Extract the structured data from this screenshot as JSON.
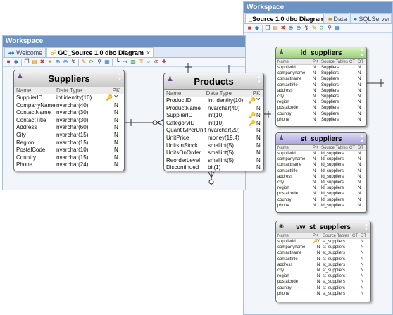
{
  "workspace_right": {
    "title": "Workspace",
    "tabs": [
      {
        "label": "_Source 1.0 dbo Diagram",
        "active": true
      },
      {
        "label": "Data",
        "active": false
      },
      {
        "label": "SQLServer",
        "active": false
      }
    ]
  },
  "workspace_left": {
    "title": "Workspace",
    "tabs": [
      {
        "label": "Welcome",
        "active": false
      },
      {
        "label": "GC_Source 1.0 dbo Diagram",
        "active": true,
        "close": "×"
      }
    ]
  },
  "toolbar_icons": [
    "stop-icon",
    "db-icon",
    "copy-icon",
    "paste-icon",
    "delete-icon",
    "arrange-icon",
    "zoom-in-icon",
    "zoom-out-icon",
    "link-icon",
    "pencil-icon",
    "refresh-icon",
    "filter-icon",
    "grid-icon",
    "layout-icon",
    "connect-icon",
    "table-icon",
    "key-icon",
    "search-icon",
    "options-icon",
    "pin-icon"
  ],
  "column_headers_big": {
    "name": "Name",
    "type": "Data Type",
    "pk": "PK"
  },
  "column_headers_small": {
    "name": "Name",
    "pk": "PK",
    "source": "Source Tables",
    "ct": "CT",
    "dt": "DT"
  },
  "suppliers": {
    "title": "Suppliers",
    "rows": [
      {
        "name": "SupplierID",
        "type": "int identity(10)",
        "key": "🔑",
        "pk": "Y"
      },
      {
        "name": "CompanyName",
        "type": "nvarchar(40)",
        "key": "",
        "pk": "N"
      },
      {
        "name": "ContactName",
        "type": "nvarchar(30)",
        "key": "",
        "pk": "N"
      },
      {
        "name": "ContactTitle",
        "type": "nvarchar(30)",
        "key": "",
        "pk": "N"
      },
      {
        "name": "Address",
        "type": "nvarchar(60)",
        "key": "",
        "pk": "N"
      },
      {
        "name": "City",
        "type": "nvarchar(15)",
        "key": "",
        "pk": "N"
      },
      {
        "name": "Region",
        "type": "nvarchar(15)",
        "key": "",
        "pk": "N"
      },
      {
        "name": "PostalCode",
        "type": "nvarchar(10)",
        "key": "",
        "pk": "N"
      },
      {
        "name": "Country",
        "type": "nvarchar(15)",
        "key": "",
        "pk": "N"
      },
      {
        "name": "Phone",
        "type": "nvarchar(24)",
        "key": "",
        "pk": "N"
      }
    ]
  },
  "products": {
    "title": "Products",
    "rows": [
      {
        "name": "ProductID",
        "type": "int identity(10)",
        "key": "🔑",
        "pk": "Y"
      },
      {
        "name": "ProductName",
        "type": "nvarchar(40)",
        "key": "",
        "pk": "N"
      },
      {
        "name": "SupplierID",
        "type": "int(10)",
        "key": "🔑",
        "pk": "N"
      },
      {
        "name": "CategoryID",
        "type": "int(10)",
        "key": "🔑",
        "pk": "N"
      },
      {
        "name": "QuantityPerUnit",
        "type": "nvarchar(20)",
        "key": "",
        "pk": "N"
      },
      {
        "name": "UnitPrice",
        "type": "money(19,4)",
        "key": "",
        "pk": "N"
      },
      {
        "name": "UnitsInStock",
        "type": "smallint(5)",
        "key": "",
        "pk": "N"
      },
      {
        "name": "UnitsOnOrder",
        "type": "smallint(5)",
        "key": "",
        "pk": "N"
      },
      {
        "name": "ReorderLevel",
        "type": "smallint(5)",
        "key": "",
        "pk": "N"
      },
      {
        "name": "Discontinued",
        "type": "bit(1)",
        "key": "",
        "pk": "N"
      }
    ]
  },
  "ld_suppliers": {
    "title": "ld_suppliers",
    "rows": [
      {
        "name": "supplierid",
        "key": "",
        "pk": "N",
        "source": "Suppliers",
        "ct": "",
        "dt": "N"
      },
      {
        "name": "companyname",
        "key": "",
        "pk": "N",
        "source": "Suppliers",
        "ct": "",
        "dt": "N"
      },
      {
        "name": "contactname",
        "key": "",
        "pk": "N",
        "source": "Suppliers",
        "ct": "",
        "dt": "N"
      },
      {
        "name": "contacttitle",
        "key": "",
        "pk": "N",
        "source": "Suppliers",
        "ct": "",
        "dt": "N"
      },
      {
        "name": "address",
        "key": "",
        "pk": "N",
        "source": "Suppliers",
        "ct": "",
        "dt": "N"
      },
      {
        "name": "city",
        "key": "",
        "pk": "N",
        "source": "Suppliers",
        "ct": "",
        "dt": "N"
      },
      {
        "name": "region",
        "key": "",
        "pk": "N",
        "source": "Suppliers",
        "ct": "",
        "dt": "N"
      },
      {
        "name": "postalcode",
        "key": "",
        "pk": "N",
        "source": "Suppliers",
        "ct": "",
        "dt": "N"
      },
      {
        "name": "country",
        "key": "",
        "pk": "N",
        "source": "Suppliers",
        "ct": "",
        "dt": "N"
      },
      {
        "name": "phone",
        "key": "",
        "pk": "N",
        "source": "Suppliers",
        "ct": "",
        "dt": "N"
      }
    ]
  },
  "st_suppliers": {
    "title": "st_suppliers",
    "rows": [
      {
        "name": "supplierid",
        "key": "",
        "pk": "N",
        "source": "ld_suppliers",
        "ct": "",
        "dt": "N"
      },
      {
        "name": "companyname",
        "key": "",
        "pk": "N",
        "source": "ld_suppliers",
        "ct": "",
        "dt": "N"
      },
      {
        "name": "contactname",
        "key": "",
        "pk": "N",
        "source": "ld_suppliers",
        "ct": "",
        "dt": "N"
      },
      {
        "name": "contacttitle",
        "key": "",
        "pk": "N",
        "source": "ld_suppliers",
        "ct": "",
        "dt": "N"
      },
      {
        "name": "address",
        "key": "",
        "pk": "N",
        "source": "ld_suppliers",
        "ct": "",
        "dt": "N"
      },
      {
        "name": "city",
        "key": "",
        "pk": "N",
        "source": "ld_suppliers",
        "ct": "",
        "dt": "N"
      },
      {
        "name": "region",
        "key": "",
        "pk": "N",
        "source": "ld_suppliers",
        "ct": "",
        "dt": "N"
      },
      {
        "name": "postalcode",
        "key": "",
        "pk": "N",
        "source": "ld_suppliers",
        "ct": "",
        "dt": "N"
      },
      {
        "name": "country",
        "key": "",
        "pk": "N",
        "source": "ld_suppliers",
        "ct": "",
        "dt": "N"
      },
      {
        "name": "phone",
        "key": "",
        "pk": "N",
        "source": "ld_suppliers",
        "ct": "",
        "dt": "N"
      }
    ]
  },
  "vw_st_suppliers": {
    "title": "vw_st_suppliers",
    "rows": [
      {
        "name": "supplierid",
        "key": "🔑",
        "pk": "Y",
        "source": "st_suppliers",
        "ct": "",
        "dt": "N"
      },
      {
        "name": "companyname",
        "key": "",
        "pk": "N",
        "source": "st_suppliers",
        "ct": "",
        "dt": "N"
      },
      {
        "name": "contactname",
        "key": "",
        "pk": "N",
        "source": "st_suppliers",
        "ct": "",
        "dt": "N"
      },
      {
        "name": "contacttitle",
        "key": "",
        "pk": "N",
        "source": "st_suppliers",
        "ct": "",
        "dt": "N"
      },
      {
        "name": "address",
        "key": "",
        "pk": "N",
        "source": "st_suppliers",
        "ct": "",
        "dt": "N"
      },
      {
        "name": "city",
        "key": "",
        "pk": "N",
        "source": "st_suppliers",
        "ct": "",
        "dt": "N"
      },
      {
        "name": "region",
        "key": "",
        "pk": "N",
        "source": "st_suppliers",
        "ct": "",
        "dt": "N"
      },
      {
        "name": "postalcode",
        "key": "",
        "pk": "N",
        "source": "st_suppliers",
        "ct": "",
        "dt": "N"
      },
      {
        "name": "country",
        "key": "",
        "pk": "N",
        "source": "st_suppliers",
        "ct": "",
        "dt": "N"
      },
      {
        "name": "phone",
        "key": "",
        "pk": "N",
        "source": "st_suppliers",
        "ct": "",
        "dt": "N"
      }
    ]
  },
  "colors": {
    "header_blue": "#6d93c4",
    "green_head": "#97cf72",
    "purple_head": "#a9a1e0",
    "grey_head": "#c8c8c8",
    "key_gold": "#c78a10"
  }
}
